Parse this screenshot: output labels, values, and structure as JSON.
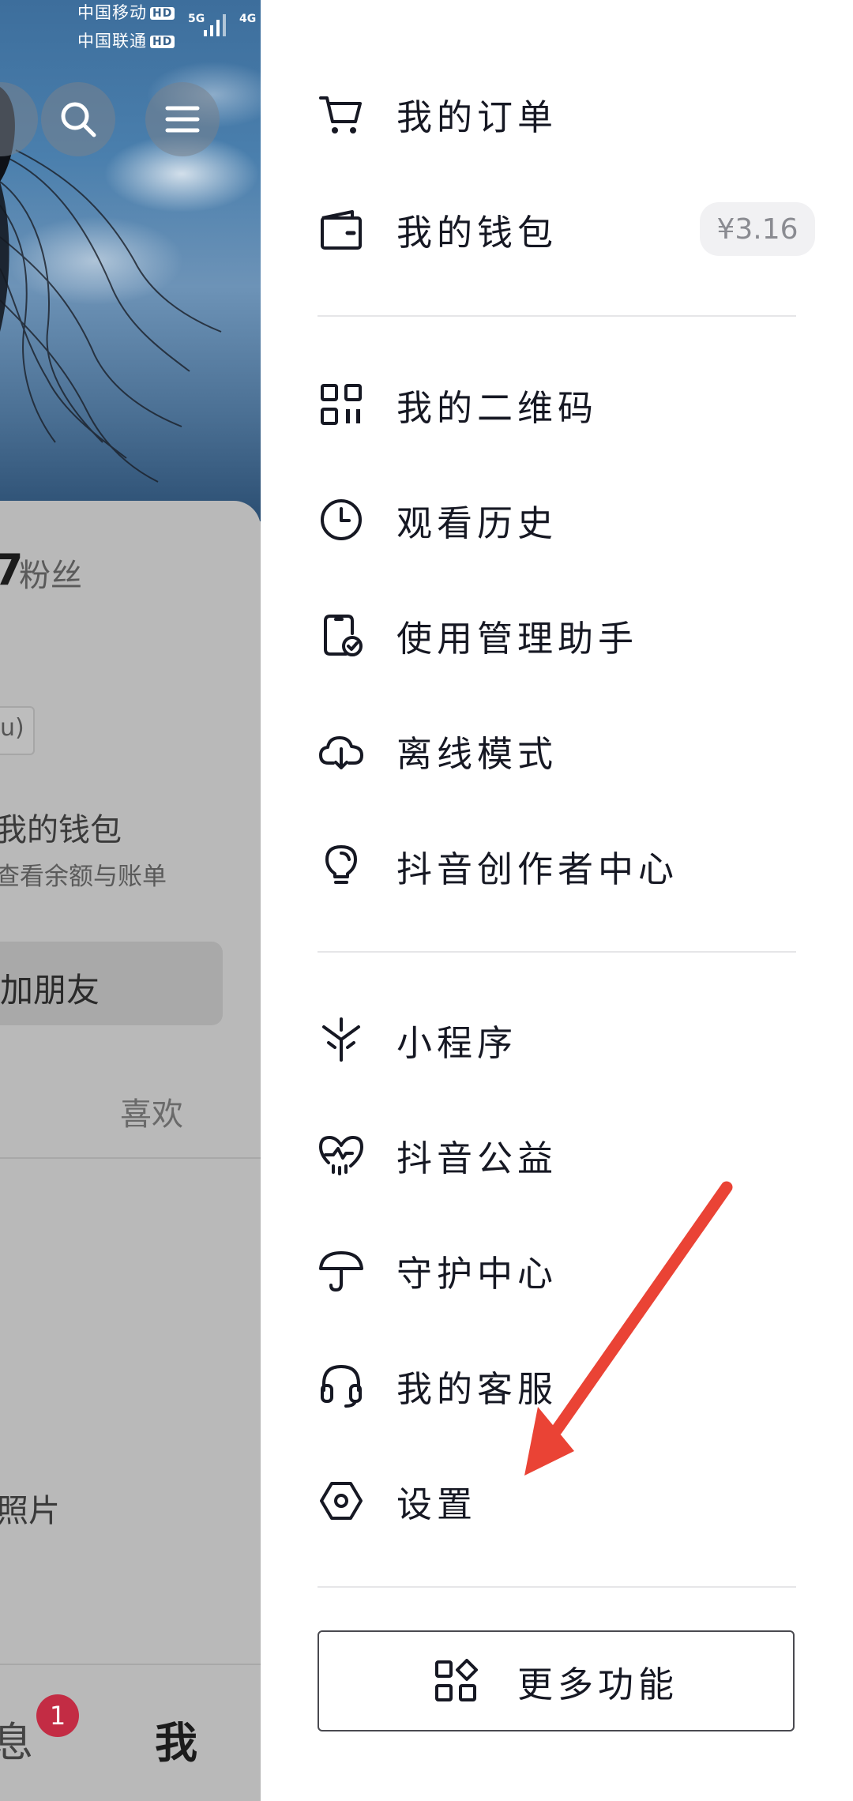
{
  "status_bar": {
    "carrier1": "中国移动",
    "carrier2": "中国联通",
    "hd_badge": "HD",
    "network1": "5G",
    "network2": "4G"
  },
  "left_page": {
    "followers_count": "7",
    "followers_label": "粉丝",
    "tag_fragment": "u)",
    "wallet_title": "我的钱包",
    "wallet_sub": "查看余额与账单",
    "add_friend": "加朋友",
    "tab_likes": "喜欢",
    "photos": "照片",
    "nav_messages": "息",
    "nav_messages_badge": "1",
    "nav_me": "我"
  },
  "drawer": {
    "group1": [
      {
        "label": "我的订单",
        "icon": "cart-icon"
      },
      {
        "label": "我的钱包",
        "icon": "wallet-icon",
        "badge": "¥3.16"
      }
    ],
    "group2": [
      {
        "label": "我的二维码",
        "icon": "qr-code-icon"
      },
      {
        "label": "观看历史",
        "icon": "clock-icon"
      },
      {
        "label": "使用管理助手",
        "icon": "phone-check-icon"
      },
      {
        "label": "离线模式",
        "icon": "cloud-download-icon"
      },
      {
        "label": "抖音创作者中心",
        "icon": "lightbulb-icon"
      }
    ],
    "group3": [
      {
        "label": "小程序",
        "icon": "mini-program-icon"
      },
      {
        "label": "抖音公益",
        "icon": "heart-charity-icon"
      },
      {
        "label": "守护中心",
        "icon": "umbrella-icon"
      },
      {
        "label": "我的客服",
        "icon": "headset-icon"
      },
      {
        "label": "设置",
        "icon": "settings-hexagon-icon"
      }
    ],
    "more_button": "更多功能"
  },
  "colors": {
    "text": "#161823",
    "divider": "#e6e6e8",
    "badge_bg": "#f1f1f3",
    "annotation_arrow": "#ea4335",
    "notification_badge": "#fe2c55"
  }
}
